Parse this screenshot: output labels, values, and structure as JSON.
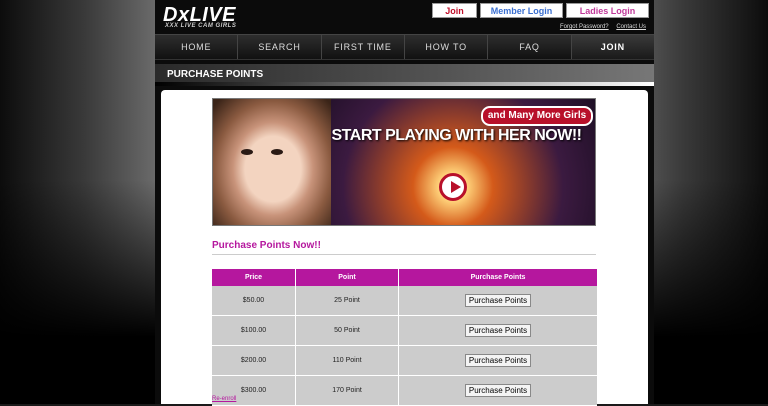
{
  "header": {
    "logo": "DxLIVE",
    "tagline": "XXX LIVE CAM GIRLS",
    "join_button": "Join",
    "member_login": "Member Login",
    "ladies_login": "Ladies Login",
    "forgot_password": "Forgot Password?",
    "contact_us": "Contact Us"
  },
  "nav": {
    "items": [
      {
        "label": "HOME"
      },
      {
        "label": "SEARCH"
      },
      {
        "label": "FIRST TIME"
      },
      {
        "label": "HOW TO"
      },
      {
        "label": "FAQ"
      },
      {
        "label": "JOIN"
      }
    ]
  },
  "section_title": "PURCHASE POINTS",
  "banner": {
    "pill": "and Many More Girls",
    "headline": "START PLAYING WITH HER NOW!!"
  },
  "purchase": {
    "title": "Purchase Points Now!!",
    "columns": [
      "Price",
      "Point",
      "Purchase Points"
    ],
    "rows": [
      {
        "price": "$50.00",
        "point": "25 Point",
        "button": "Purchase Points"
      },
      {
        "price": "$100.00",
        "point": "50 Point",
        "button": "Purchase Points"
      },
      {
        "price": "$200.00",
        "point": "110 Point",
        "button": "Purchase Points"
      },
      {
        "price": "$300.00",
        "point": "170 Point",
        "button": "Purchase Points"
      }
    ],
    "footer_link": "Re-enroll"
  },
  "colors": {
    "accent": "#b5179e",
    "join": "#c0102a",
    "member": "#3a6fd0",
    "ladies": "#c03a9a"
  }
}
